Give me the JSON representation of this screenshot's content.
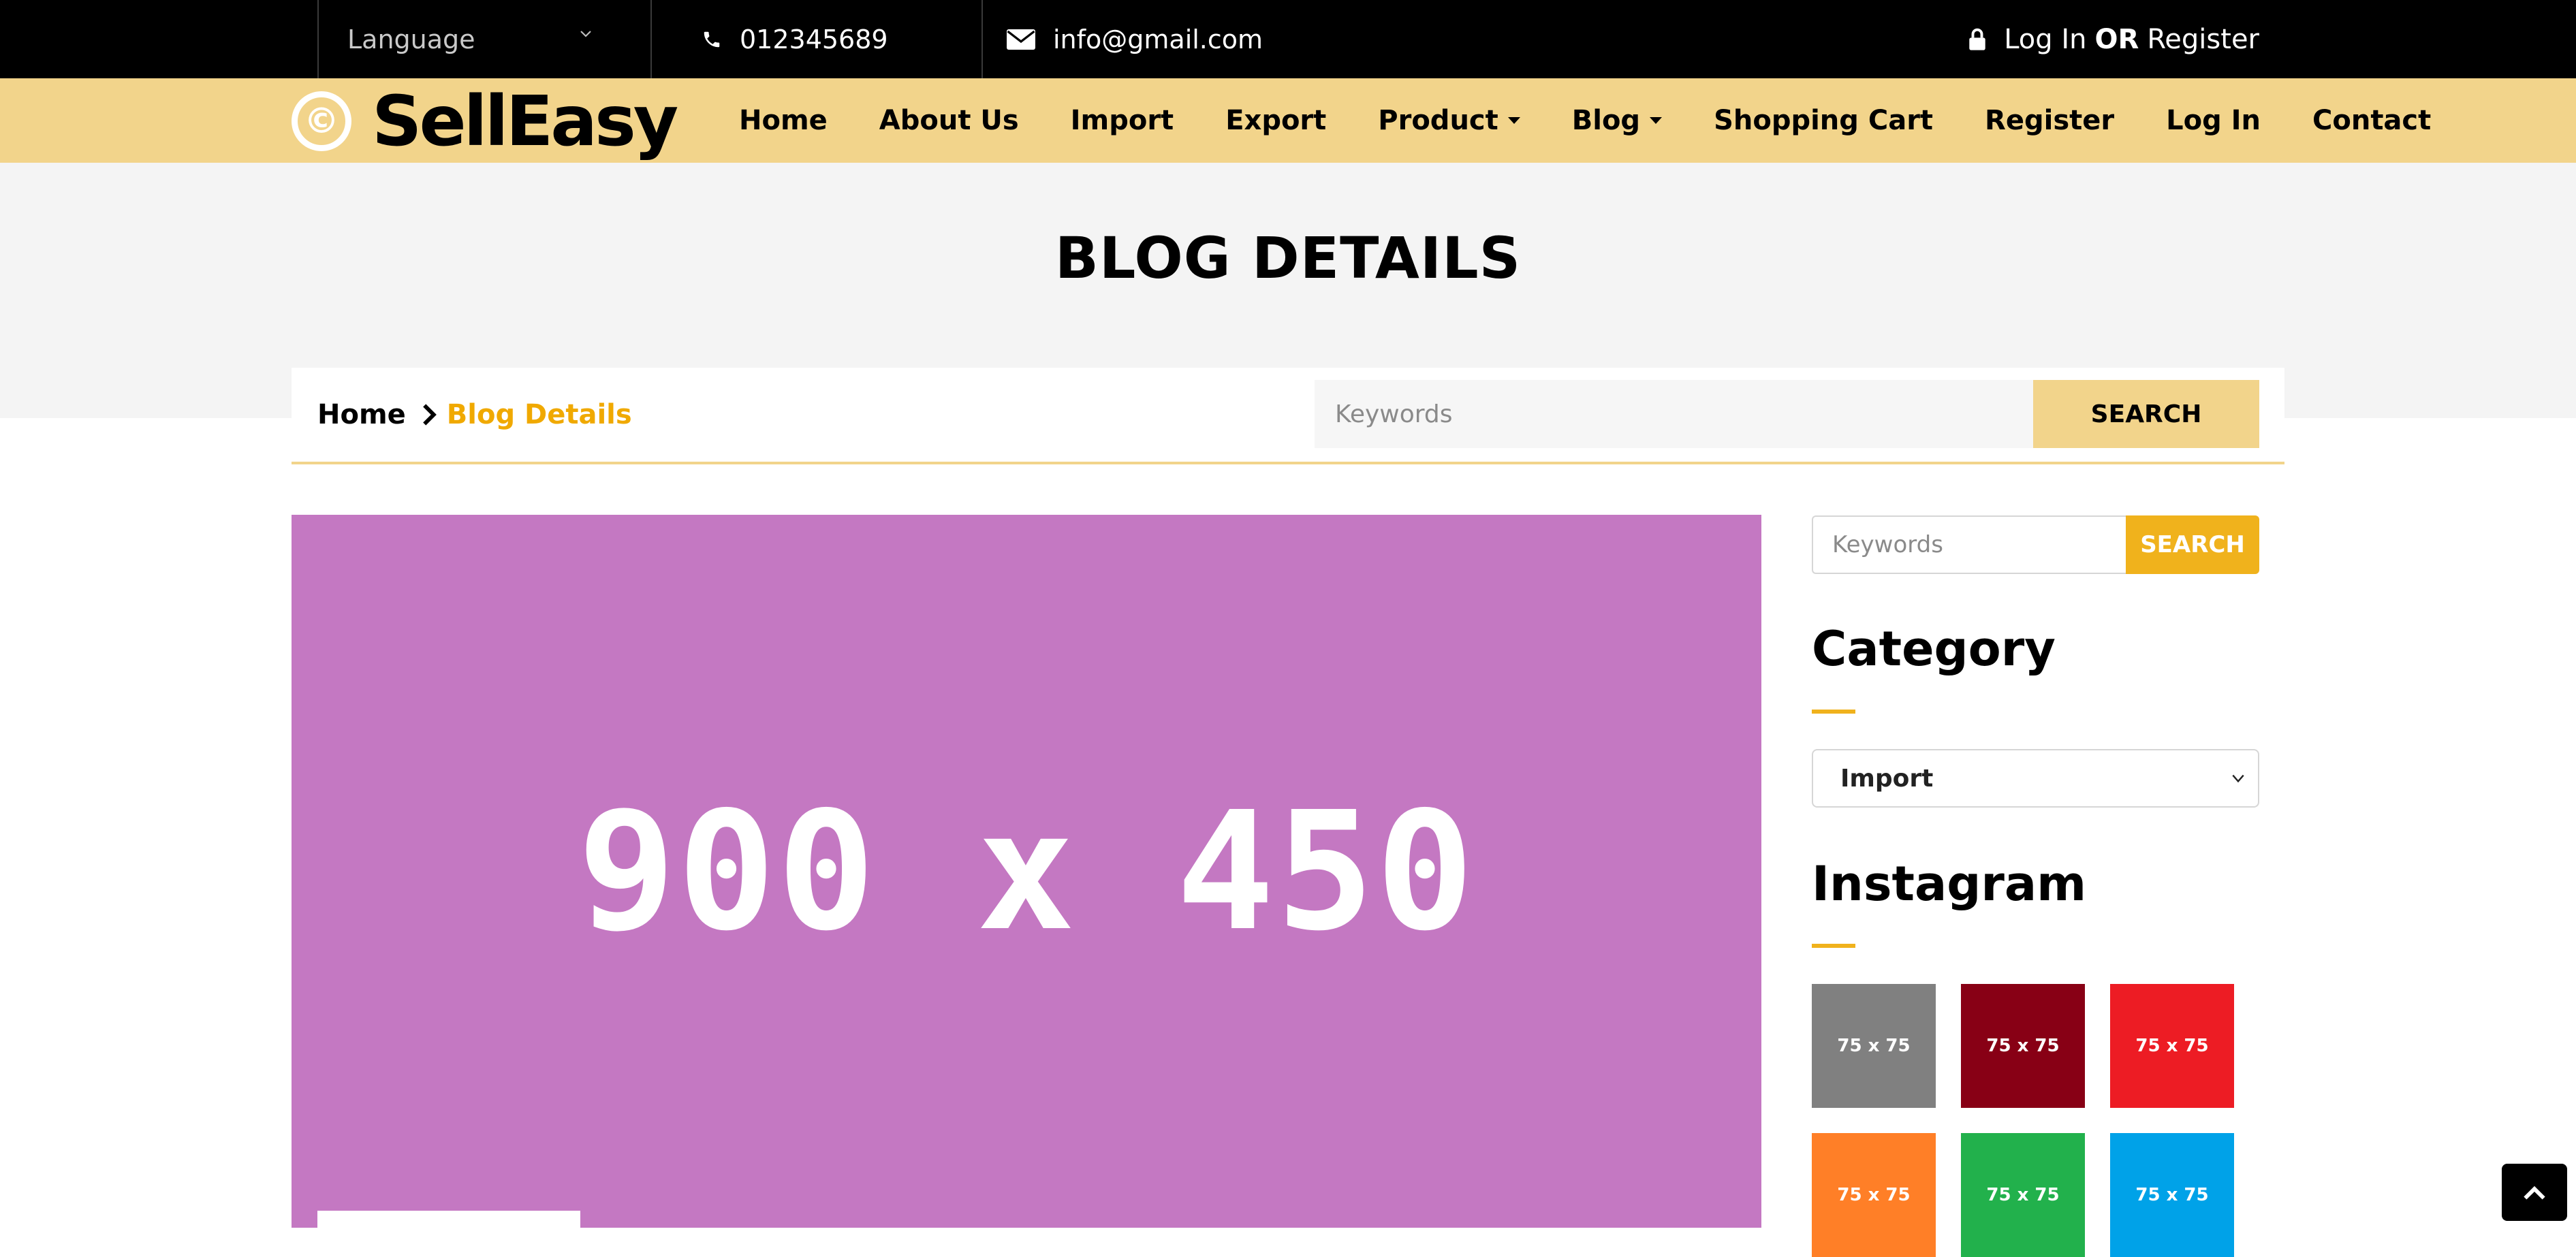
{
  "topbar": {
    "language_label": "Language",
    "phone": "012345689",
    "email": "info@gmail.com",
    "login_label": "Log In",
    "or_label": "OR",
    "register_label": "Register",
    "icons": [
      "chevron-down-icon",
      "phone-icon",
      "envelope-icon",
      "lock-icon"
    ]
  },
  "brand": {
    "logo_mark": "©",
    "name": "SellEasy",
    "accent": "#f2d48b"
  },
  "nav": {
    "items": [
      {
        "label": "Home",
        "dropdown": false
      },
      {
        "label": "About Us",
        "dropdown": false
      },
      {
        "label": "Import",
        "dropdown": false
      },
      {
        "label": "Export",
        "dropdown": false
      },
      {
        "label": "Product",
        "dropdown": true
      },
      {
        "label": "Blog",
        "dropdown": true
      },
      {
        "label": "Shopping Cart",
        "dropdown": false
      },
      {
        "label": "Register",
        "dropdown": false
      },
      {
        "label": "Log In",
        "dropdown": false
      },
      {
        "label": "Contact",
        "dropdown": false
      }
    ]
  },
  "page": {
    "title": "BLOG DETAILS"
  },
  "breadcrumb": {
    "home": "Home",
    "current": "Blog Details",
    "current_color": "#f0a900"
  },
  "search_main": {
    "placeholder": "Keywords",
    "button": "SEARCH"
  },
  "main_image": {
    "label": "900 x 450",
    "color": "#c478c2"
  },
  "sidebar": {
    "search_placeholder": "Keywords",
    "search_button": "SEARCH",
    "accent": "#f0b21c",
    "category_heading": "Category",
    "category_selected": "Import",
    "instagram_heading": "Instagram",
    "thumbnails": [
      {
        "label": "75 x 75",
        "color": "#808080"
      },
      {
        "label": "75 x 75",
        "color": "#880015"
      },
      {
        "label": "75 x 75",
        "color": "#ed1c24"
      },
      {
        "label": "75 x 75",
        "color": "#ff7f27"
      },
      {
        "label": "75 x 75",
        "color": "#22b14c"
      },
      {
        "label": "75 x 75",
        "color": "#00a2e8"
      }
    ]
  },
  "back_to_top_icon": "chevron-up-icon"
}
